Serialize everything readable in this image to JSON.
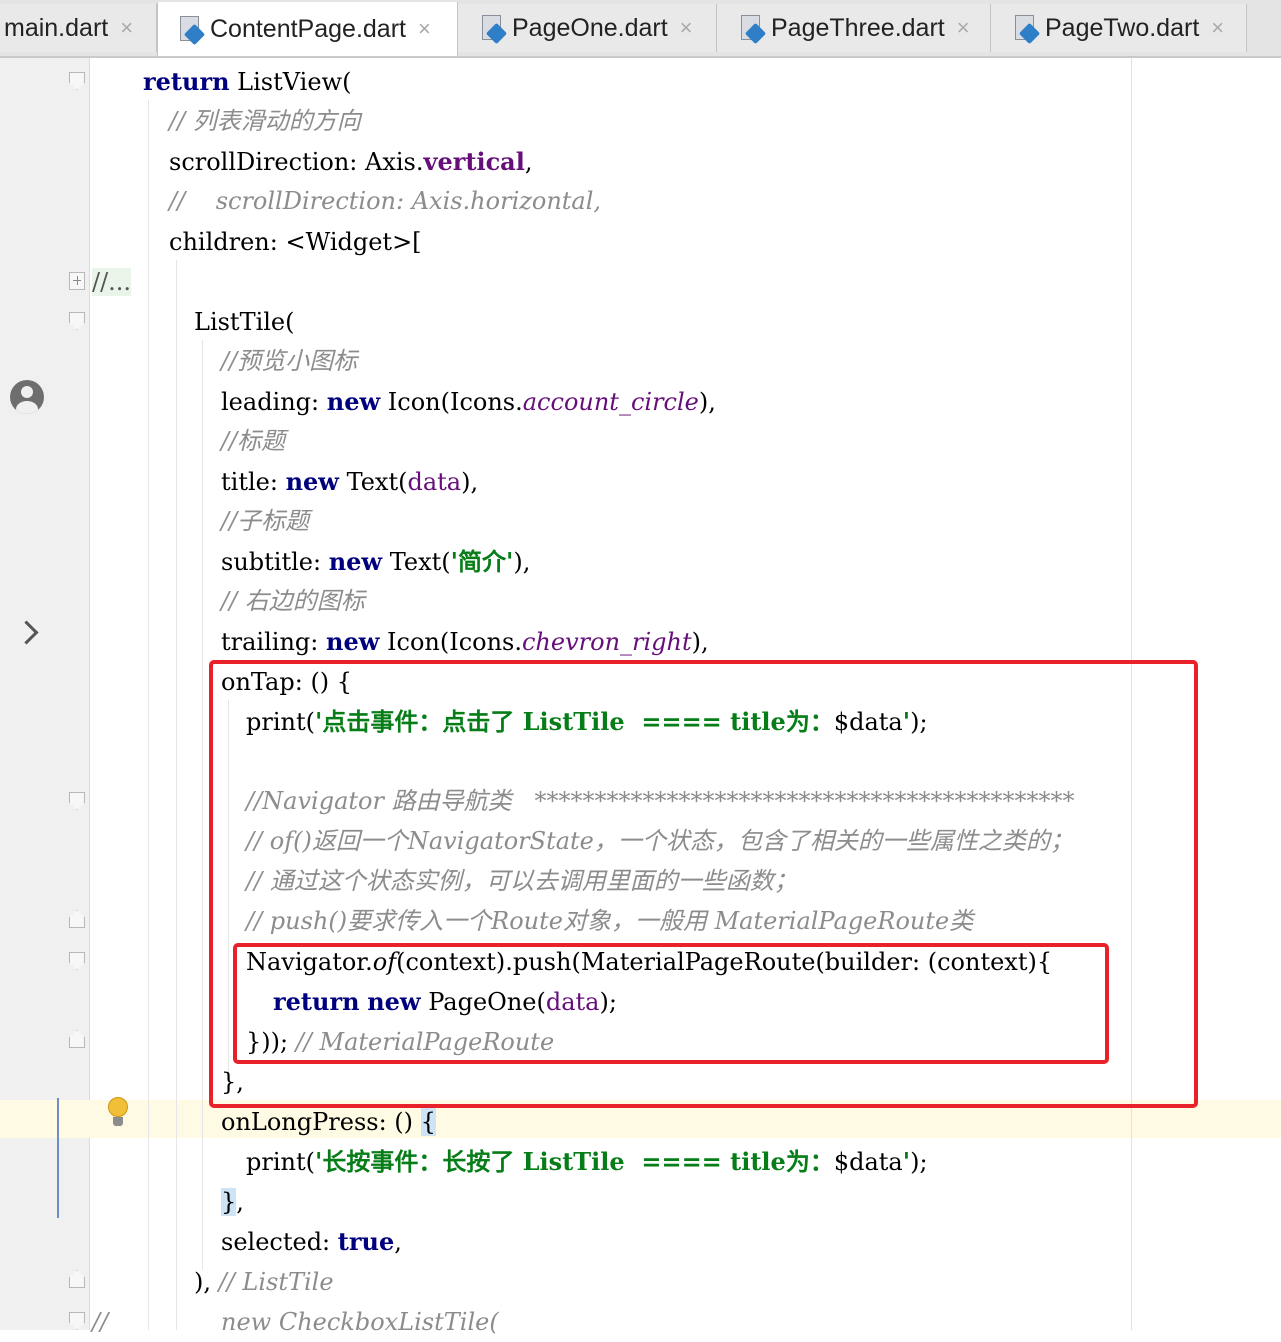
{
  "tabs": [
    {
      "label": "main.dart",
      "active": false
    },
    {
      "label": "ContentPage.dart",
      "active": true
    },
    {
      "label": "PageOne.dart",
      "active": false
    },
    {
      "label": "PageThree.dart",
      "active": false
    },
    {
      "label": "PageTwo.dart",
      "active": false
    }
  ],
  "tab_close_glyph": "×",
  "gutter_icons": [
    "account-circle-icon",
    "chevron-right-icon",
    "lightbulb-icon"
  ],
  "colors": {
    "keyword": "#00007f",
    "string": "#067d17",
    "comment": "#8c8c8c",
    "field": "#660e7a",
    "highlight_box": "#e8212a",
    "caret_row": "#fffae3"
  },
  "code": {
    "l1_kw": "return",
    "l1_rest": " ListView(",
    "l2": "// 列表滑动的方向",
    "l3_a": "scrollDirection: Axis.",
    "l3_b": "vertical",
    "l3_c": ",",
    "l4": "//    scrollDirection: Axis.horizontal,",
    "l5": "children: <Widget>[",
    "l6": "//...",
    "l7": "ListTile(",
    "l8": "//预览小图标",
    "l9_a": "leading: ",
    "l9_kw": "new",
    "l9_b": " Icon(Icons.",
    "l9_c": "account_circle",
    "l9_d": "),",
    "l10": "//标题",
    "l11_a": "title: ",
    "l11_kw": "new",
    "l11_b": " Text(",
    "l11_c": "data",
    "l11_d": "),",
    "l12": "//子标题",
    "l13_a": "subtitle: ",
    "l13_kw": "new",
    "l13_b": " Text(",
    "l13_s": "'简介'",
    "l13_d": "),",
    "l14": "// 右边的图标",
    "l15_a": "trailing: ",
    "l15_kw": "new",
    "l15_b": " Icon(Icons.",
    "l15_c": "chevron_right",
    "l15_d": "),",
    "l16": "onTap: () {",
    "l17_a": "print(",
    "l17_s": "'点击事件：点击了 ListTile  ==== title为：",
    "l17_v": "$data",
    "l17_e": "'",
    "l17_f": ");",
    "l18": "//Navigator 路由导航类   *********************************************",
    "l19": "// of()返回一个NavigatorState，一个状态，包含了相关的一些属性之类的；",
    "l20": "// 通过这个状态实例，可以去调用里面的一些函数；",
    "l21": "// push()要求传入一个Route对象，一般用 MaterialPageRoute类",
    "l22_a": "Navigator.",
    "l22_b": "of",
    "l22_c": "(context).push(MaterialPageRoute(builder: (context){",
    "l23_kw1": "return",
    "l23_sp": " ",
    "l23_kw2": "new",
    "l23_b": " PageOne(",
    "l23_c": "data",
    "l23_d": ");",
    "l24_a": "})); ",
    "l24_cm": "// MaterialPageRoute",
    "l25": "},",
    "l26_a": "onLongPress: () ",
    "l26_b": "{",
    "l27_a": "print(",
    "l27_s": "'长按事件：长按了 ListTile  ==== title为：",
    "l27_v": "$data",
    "l27_e": "'",
    "l27_f": ");",
    "l28_a": "}",
    "l28_b": ",",
    "l29_a": "selected: ",
    "l29_kw": "true",
    "l29_b": ",",
    "l30_a": "), ",
    "l30_cm": "// ListTile",
    "l31": "new CheckboxListTile(",
    "l31_pre": "//"
  }
}
